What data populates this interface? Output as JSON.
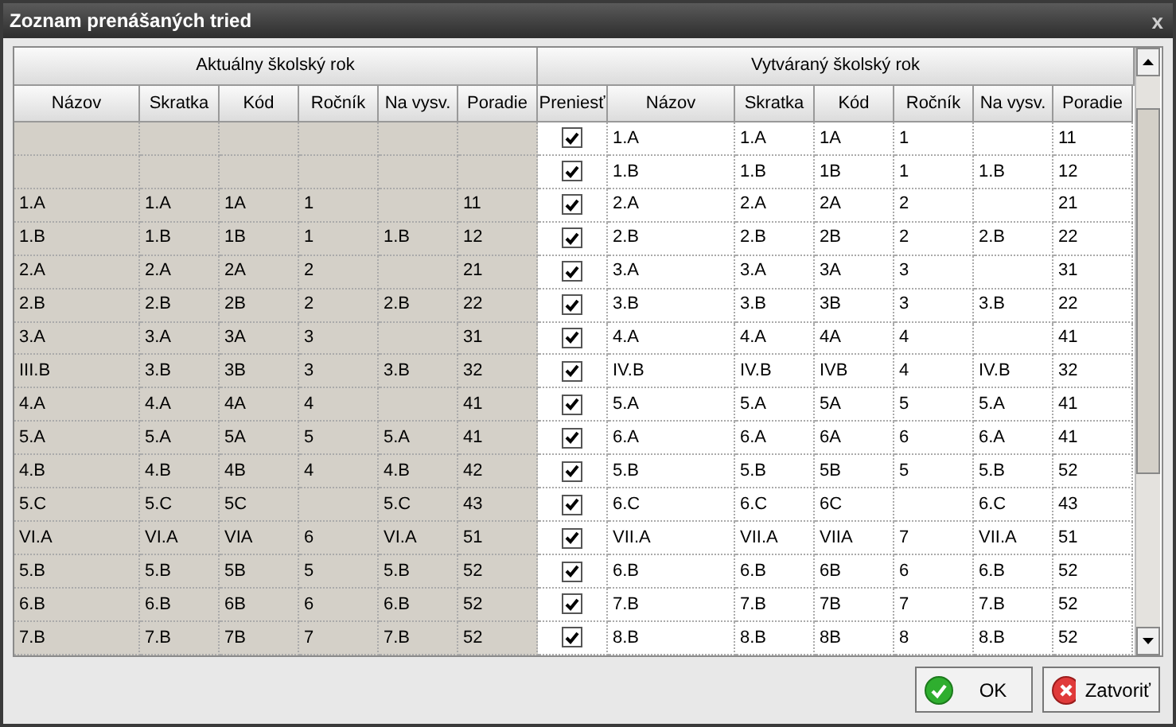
{
  "window": {
    "title": "Zoznam prenášaných tried",
    "close": "x"
  },
  "table": {
    "groups": [
      "Aktuálny školský rok",
      "Vytváraný školský rok"
    ],
    "current_columns": [
      "Názov",
      "Skratka",
      "Kód",
      "Ročník",
      "Na vysv.",
      "Poradie"
    ],
    "transfer_column": "Preniesť",
    "new_columns": [
      "Názov",
      "Skratka",
      "Kód",
      "Ročník",
      "Na vysv.",
      "Poradie"
    ],
    "rows": [
      {
        "transfer": true,
        "new": {
          "nazov": "1.A",
          "skratka": "1.A",
          "kod": "1A",
          "rocnik": "1",
          "poradie": "11"
        }
      },
      {
        "transfer": true,
        "new": {
          "nazov": "1.B",
          "skratka": "1.B",
          "kod": "1B",
          "rocnik": "1",
          "na_vysv": "1.B",
          "poradie": "12"
        }
      },
      {
        "current": {
          "nazov": "1.A",
          "skratka": "1.A",
          "kod": "1A",
          "rocnik": "1",
          "poradie": "11"
        },
        "transfer": true,
        "new": {
          "nazov": "2.A",
          "skratka": "2.A",
          "kod": "2A",
          "rocnik": "2",
          "poradie": "21"
        }
      },
      {
        "current": {
          "nazov": "1.B",
          "skratka": "1.B",
          "kod": "1B",
          "rocnik": "1",
          "na_vysv": "1.B",
          "poradie": "12"
        },
        "transfer": true,
        "new": {
          "nazov": "2.B",
          "skratka": "2.B",
          "kod": "2B",
          "rocnik": "2",
          "na_vysv": "2.B",
          "poradie": "22"
        }
      },
      {
        "current": {
          "nazov": "2.A",
          "skratka": "2.A",
          "kod": "2A",
          "rocnik": "2",
          "poradie": "21"
        },
        "transfer": true,
        "new": {
          "nazov": "3.A",
          "skratka": "3.A",
          "kod": "3A",
          "rocnik": "3",
          "poradie": "31"
        }
      },
      {
        "current": {
          "nazov": "2.B",
          "skratka": "2.B",
          "kod": "2B",
          "rocnik": "2",
          "na_vysv": "2.B",
          "poradie": "22"
        },
        "transfer": true,
        "new": {
          "nazov": "3.B",
          "skratka": "3.B",
          "kod": "3B",
          "rocnik": "3",
          "na_vysv": "3.B",
          "poradie": "22"
        }
      },
      {
        "current": {
          "nazov": "3.A",
          "skratka": "3.A",
          "kod": "3A",
          "rocnik": "3",
          "poradie": "31"
        },
        "transfer": true,
        "new": {
          "nazov": "4.A",
          "skratka": "4.A",
          "kod": "4A",
          "rocnik": "4",
          "poradie": "41"
        }
      },
      {
        "current": {
          "nazov": "III.B",
          "skratka": "3.B",
          "kod": "3B",
          "rocnik": "3",
          "na_vysv": "3.B",
          "poradie": "32"
        },
        "transfer": true,
        "new": {
          "nazov": "IV.B",
          "skratka": "IV.B",
          "kod": "IVB",
          "rocnik": "4",
          "na_vysv": "IV.B",
          "poradie": "32"
        }
      },
      {
        "current": {
          "nazov": "4.A",
          "skratka": "4.A",
          "kod": "4A",
          "rocnik": "4",
          "poradie": "41"
        },
        "transfer": true,
        "new": {
          "nazov": "5.A",
          "skratka": "5.A",
          "kod": "5A",
          "rocnik": "5",
          "na_vysv": "5.A",
          "poradie": "41"
        }
      },
      {
        "current": {
          "nazov": "5.A",
          "skratka": "5.A",
          "kod": "5A",
          "rocnik": "5",
          "na_vysv": "5.A",
          "poradie": "41"
        },
        "transfer": true,
        "new": {
          "nazov": "6.A",
          "skratka": "6.A",
          "kod": "6A",
          "rocnik": "6",
          "na_vysv": "6.A",
          "poradie": "41"
        }
      },
      {
        "current": {
          "nazov": "4.B",
          "skratka": "4.B",
          "kod": "4B",
          "rocnik": "4",
          "na_vysv": "4.B",
          "poradie": "42"
        },
        "transfer": true,
        "new": {
          "nazov": "5.B",
          "skratka": "5.B",
          "kod": "5B",
          "rocnik": "5",
          "na_vysv": "5.B",
          "poradie": "52"
        }
      },
      {
        "current": {
          "nazov": "5.C",
          "skratka": "5.C",
          "kod": "5C",
          "na_vysv": "5.C",
          "poradie": "43"
        },
        "transfer": true,
        "new": {
          "nazov": "6.C",
          "skratka": "6.C",
          "kod": "6C",
          "na_vysv": "6.C",
          "poradie": "43"
        }
      },
      {
        "current": {
          "nazov": "VI.A",
          "skratka": "VI.A",
          "kod": "VIA",
          "rocnik": "6",
          "na_vysv": "VI.A",
          "poradie": "51"
        },
        "transfer": true,
        "new": {
          "nazov": "VII.A",
          "skratka": "VII.A",
          "kod": "VIIA",
          "rocnik": "7",
          "na_vysv": "VII.A",
          "poradie": "51"
        }
      },
      {
        "current": {
          "nazov": "5.B",
          "skratka": "5.B",
          "kod": "5B",
          "rocnik": "5",
          "na_vysv": "5.B",
          "poradie": "52"
        },
        "transfer": true,
        "new": {
          "nazov": "6.B",
          "skratka": "6.B",
          "kod": "6B",
          "rocnik": "6",
          "na_vysv": "6.B",
          "poradie": "52"
        }
      },
      {
        "current": {
          "nazov": "6.B",
          "skratka": "6.B",
          "kod": "6B",
          "rocnik": "6",
          "na_vysv": "6.B",
          "poradie": "52"
        },
        "transfer": true,
        "new": {
          "nazov": "7.B",
          "skratka": "7.B",
          "kod": "7B",
          "rocnik": "7",
          "na_vysv": "7.B",
          "poradie": "52"
        }
      },
      {
        "current": {
          "nazov": "7.B",
          "skratka": "7.B",
          "kod": "7B",
          "rocnik": "7",
          "na_vysv": "7.B",
          "poradie": "52"
        },
        "transfer": true,
        "new": {
          "nazov": "8.B",
          "skratka": "8.B",
          "kod": "8B",
          "rocnik": "8",
          "na_vysv": "8.B",
          "poradie": "52"
        }
      }
    ]
  },
  "buttons": [
    {
      "kind": "ok",
      "label": "OK"
    },
    {
      "kind": "close",
      "label": "Zatvoriť"
    }
  ]
}
